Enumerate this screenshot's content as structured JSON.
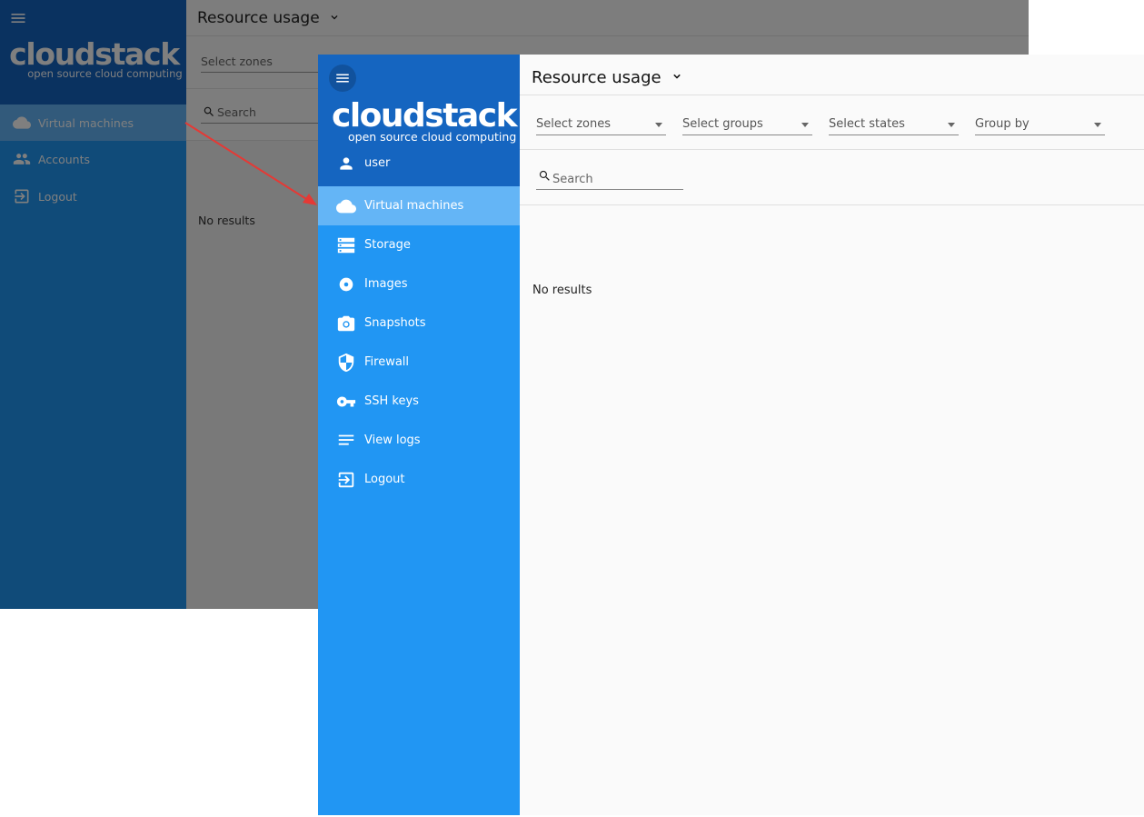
{
  "back_view": {
    "title": "Resource usage",
    "logo": {
      "wordmark": "cloudstack",
      "tagline": "open source cloud computing"
    },
    "sidebar": {
      "items": [
        {
          "label": "Virtual machines",
          "icon": "cloud-icon",
          "active": true
        },
        {
          "label": "Accounts",
          "icon": "people-icon",
          "active": false
        },
        {
          "label": "Logout",
          "icon": "logout-icon",
          "active": false
        }
      ]
    },
    "filters": {
      "zones_placeholder": "Select zones"
    },
    "search": {
      "placeholder": "Search"
    },
    "empty_text": "No results",
    "dimmed": true
  },
  "front_view": {
    "title": "Resource usage",
    "logo": {
      "wordmark": "cloudstack",
      "tagline": "open source cloud computing"
    },
    "user": {
      "name": "user"
    },
    "sidebar": {
      "items": [
        {
          "label": "Virtual machines",
          "icon": "cloud-icon",
          "active": true
        },
        {
          "label": "Storage",
          "icon": "storage-icon",
          "active": false
        },
        {
          "label": "Images",
          "icon": "disc-icon",
          "active": false
        },
        {
          "label": "Snapshots",
          "icon": "camera-icon",
          "active": false
        },
        {
          "label": "Firewall",
          "icon": "shield-icon",
          "active": false
        },
        {
          "label": "SSH keys",
          "icon": "key-icon",
          "active": false
        },
        {
          "label": "View logs",
          "icon": "list-icon",
          "active": false
        },
        {
          "label": "Logout",
          "icon": "logout-icon",
          "active": false
        }
      ]
    },
    "filters": {
      "zones": "Select zones",
      "groups": "Select groups",
      "states": "Select states",
      "group_by": "Group by"
    },
    "search": {
      "placeholder": "Search"
    },
    "empty_text": "No results"
  },
  "colors": {
    "sidebar": "#2196f3",
    "sidebar_header": "#1565c0",
    "active_item": "#64b5f6",
    "arrow": "#e53935"
  }
}
